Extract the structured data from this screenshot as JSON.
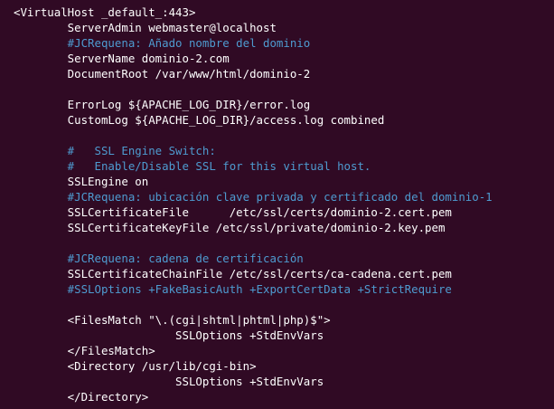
{
  "colors": {
    "background": "#300a24",
    "text": "#ffffff",
    "comment": "#4e9bd0"
  },
  "code": {
    "lines": [
      "<VirtualHost _default_:443>",
      "        ServerAdmin webmaster@localhost",
      "        #JCRequena: Añado nombre del dominio",
      "        ServerName dominio-2.com",
      "        DocumentRoot /var/www/html/dominio-2",
      "",
      "        ErrorLog ${APACHE_LOG_DIR}/error.log",
      "        CustomLog ${APACHE_LOG_DIR}/access.log combined",
      "",
      "        #   SSL Engine Switch:",
      "        #   Enable/Disable SSL for this virtual host.",
      "        SSLEngine on",
      "        #JCRequena: ubicación clave privada y certificado del dominio-1",
      "        SSLCertificateFile      /etc/ssl/certs/dominio-2.cert.pem",
      "        SSLCertificateKeyFile /etc/ssl/private/dominio-2.key.pem",
      "",
      "        #JCRequena: cadena de certificación",
      "        SSLCertificateChainFile /etc/ssl/certs/ca-cadena.cert.pem",
      "        #SSLOptions +FakeBasicAuth +ExportCertData +StrictRequire",
      "",
      "        <FilesMatch \"\\.(cgi|shtml|phtml|php)$\">",
      "                        SSLOptions +StdEnvVars",
      "        </FilesMatch>",
      "        <Directory /usr/lib/cgi-bin>",
      "                        SSLOptions +StdEnvVars",
      "        </Directory>"
    ]
  }
}
